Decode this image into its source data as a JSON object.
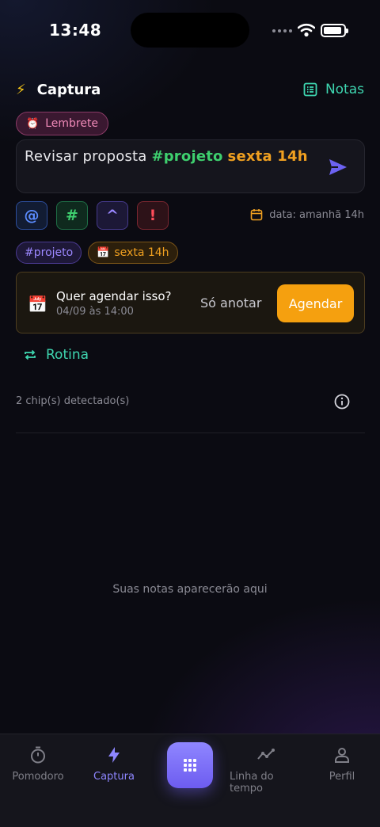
{
  "status_bar": {
    "time": "13:48"
  },
  "header": {
    "title": "Captura",
    "notes_label": "Notas"
  },
  "reminder_chip": {
    "icon": "alarm-clock-icon",
    "label": "Lembrete"
  },
  "input": {
    "plain_text": "Revisar proposta ",
    "tag_text": "#projeto",
    "date_text": "sexta 14h"
  },
  "tools": {
    "mention": "@",
    "tag": "#",
    "priority_up": "^",
    "important": "!"
  },
  "date_hint": "data: amanhã 14h",
  "detected_chips": [
    {
      "label": "#projeto",
      "color": "#9c88ff"
    },
    {
      "label": "sexta 14h",
      "color": "#f0a020",
      "icon": "calendar-icon"
    }
  ],
  "schedule_card": {
    "question": "Quer agendar isso?",
    "datetime": "04/09 às 14:00",
    "skip_label": "Só anotar",
    "confirm_label": "Agendar",
    "accent": "#f5a00f"
  },
  "routine_label": "Rotina",
  "detected_count_label": "2 chip(s) detectado(s)",
  "empty_state": "Suas notas aparecerão aqui",
  "nav": {
    "pomodoro": "Pomodoro",
    "capture": "Captura",
    "timeline": "Linha do tempo",
    "profile": "Perfil"
  },
  "colors": {
    "accent_teal": "#3ed6b0",
    "accent_purple": "#8e86ff",
    "background": "#0b0b12"
  }
}
